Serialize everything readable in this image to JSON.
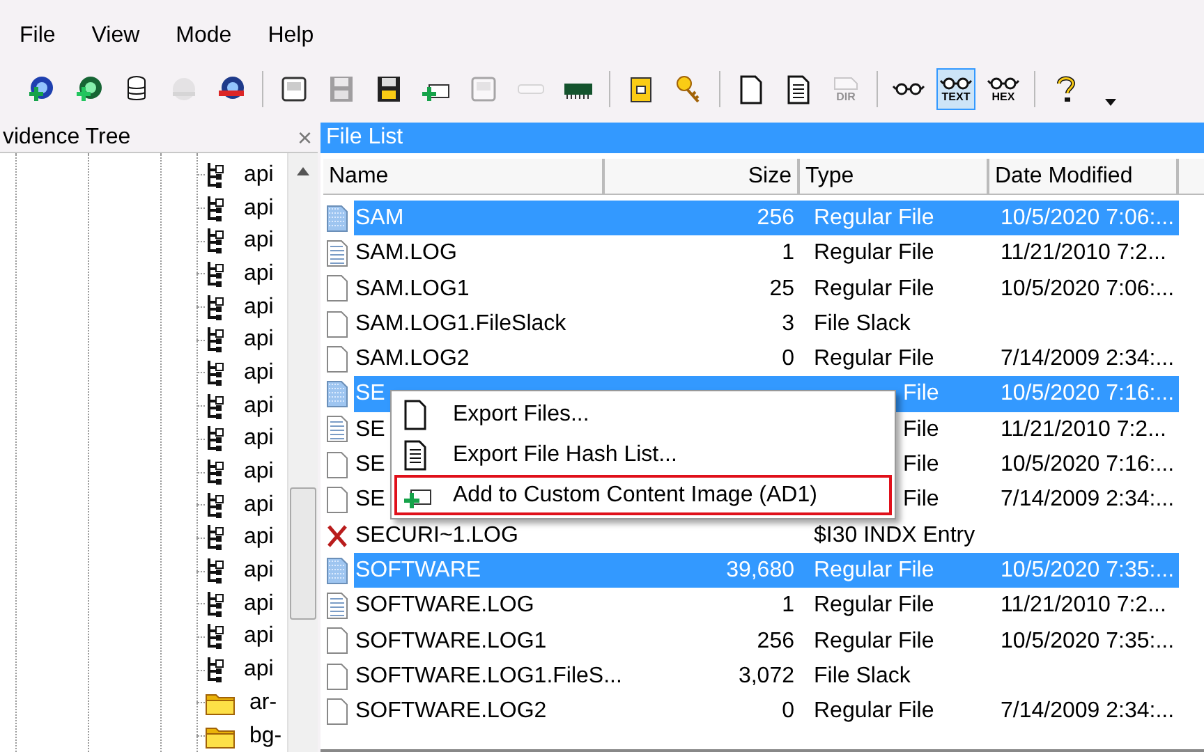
{
  "menu": [
    {
      "label": "File"
    },
    {
      "label": "View"
    },
    {
      "label": "Mode"
    },
    {
      "label": "Help"
    }
  ],
  "toolbar": [
    {
      "kind": "add-evidence",
      "disabled": false,
      "selected": false
    },
    {
      "kind": "add-all",
      "disabled": false,
      "selected": false
    },
    {
      "kind": "stack",
      "disabled": false,
      "selected": false
    },
    {
      "kind": "remove-evidence",
      "disabled": true,
      "selected": false
    },
    {
      "kind": "remove-all",
      "disabled": false,
      "selected": false
    },
    {
      "kind": "separator"
    },
    {
      "kind": "drive",
      "disabled": false,
      "selected": false
    },
    {
      "kind": "floppy",
      "disabled": true,
      "selected": false
    },
    {
      "kind": "floppy",
      "disabled": false,
      "selected": false
    },
    {
      "kind": "add-image",
      "disabled": false,
      "selected": false
    },
    {
      "kind": "drive",
      "disabled": true,
      "selected": false
    },
    {
      "kind": "bar",
      "disabled": true,
      "selected": false
    },
    {
      "kind": "memory",
      "disabled": false,
      "selected": false
    },
    {
      "kind": "separator"
    },
    {
      "kind": "case",
      "disabled": false,
      "selected": false
    },
    {
      "kind": "key",
      "disabled": false,
      "selected": false
    },
    {
      "kind": "separator"
    },
    {
      "kind": "page",
      "disabled": false,
      "selected": false
    },
    {
      "kind": "lines",
      "disabled": false,
      "selected": false
    },
    {
      "kind": "tagged",
      "label": "DIR",
      "disabled": true,
      "selected": false
    },
    {
      "kind": "separator"
    },
    {
      "kind": "glasses",
      "disabled": false,
      "selected": false
    },
    {
      "kind": "glasses",
      "label": "TEXT",
      "disabled": false,
      "selected": true
    },
    {
      "kind": "glasses",
      "label": "HEX",
      "disabled": false,
      "selected": false
    },
    {
      "kind": "separator"
    },
    {
      "kind": "help",
      "disabled": false,
      "selected": false
    },
    {
      "kind": "caret"
    }
  ],
  "evidence_tree": {
    "title": "vidence Tree",
    "close": "×",
    "items": [
      {
        "kind": "key",
        "label": "api"
      },
      {
        "kind": "key",
        "label": "api"
      },
      {
        "kind": "key",
        "label": "api"
      },
      {
        "kind": "key",
        "label": "api"
      },
      {
        "kind": "key",
        "label": "api"
      },
      {
        "kind": "key",
        "label": "api"
      },
      {
        "kind": "key",
        "label": "api"
      },
      {
        "kind": "key",
        "label": "api"
      },
      {
        "kind": "key",
        "label": "api"
      },
      {
        "kind": "key",
        "label": "api"
      },
      {
        "kind": "key",
        "label": "api"
      },
      {
        "kind": "key",
        "label": "api"
      },
      {
        "kind": "key",
        "label": "api"
      },
      {
        "kind": "key",
        "label": "api"
      },
      {
        "kind": "key",
        "label": "api"
      },
      {
        "kind": "key",
        "label": "api"
      },
      {
        "kind": "folder",
        "label": "ar-"
      },
      {
        "kind": "folder",
        "label": "bg-"
      }
    ]
  },
  "file_list": {
    "title": "File List",
    "columns": [
      "Name",
      "Size",
      "Type",
      "Date Modified"
    ],
    "rows": [
      {
        "kind": "registry",
        "name": "SAM",
        "size": "256",
        "type": "Regular File",
        "date": "10/5/2020 7:06:...",
        "selected": true
      },
      {
        "kind": "log",
        "name": "SAM.LOG",
        "size": "1",
        "type": "Regular File",
        "date": "11/21/2010 7:2...",
        "selected": false
      },
      {
        "kind": "file",
        "name": "SAM.LOG1",
        "size": "25",
        "type": "Regular File",
        "date": "10/5/2020 7:06:...",
        "selected": false
      },
      {
        "kind": "file",
        "name": "SAM.LOG1.FileSlack",
        "size": "3",
        "type": "File Slack",
        "selected": false
      },
      {
        "kind": "file",
        "name": "SAM.LOG2",
        "size": "0",
        "type": "Regular File",
        "date": "7/14/2009 2:34:...",
        "selected": false
      },
      {
        "kind": "registry",
        "name": "SE",
        "type": "File",
        "date": "10/5/2020 7:16:...",
        "selected": true,
        "covered": true
      },
      {
        "kind": "log",
        "name": "SE",
        "type": "File",
        "date": "11/21/2010 7:2...",
        "selected": false,
        "covered": true
      },
      {
        "kind": "file",
        "name": "SE",
        "type": "File",
        "date": "10/5/2020 7:16:...",
        "selected": false,
        "covered": true
      },
      {
        "kind": "file",
        "name": "SE",
        "type": "File",
        "date": "7/14/2009 2:34:...",
        "selected": false,
        "covered": true
      },
      {
        "kind": "deleted",
        "name": "SECURI~1.LOG",
        "type": "$I30 INDX Entry",
        "selected": false
      },
      {
        "kind": "registry",
        "name": "SOFTWARE",
        "size": "39,680",
        "type": "Regular File",
        "date": "10/5/2020 7:35:...",
        "selected": true
      },
      {
        "kind": "log",
        "name": "SOFTWARE.LOG",
        "size": "1",
        "type": "Regular File",
        "date": "11/21/2010 7:2...",
        "selected": false
      },
      {
        "kind": "file",
        "name": "SOFTWARE.LOG1",
        "size": "256",
        "type": "Regular File",
        "date": "10/5/2020 7:35:...",
        "selected": false
      },
      {
        "kind": "file",
        "name": "SOFTWARE.LOG1.FileS...",
        "size": "3,072",
        "type": "File Slack",
        "selected": false
      },
      {
        "kind": "file",
        "name": "SOFTWARE.LOG2",
        "size": "0",
        "type": "Regular File",
        "date": "7/14/2009 2:34:...",
        "selected": false
      }
    ]
  },
  "context_menu": [
    {
      "kind": "page",
      "label": "Export Files...",
      "outlined": false
    },
    {
      "kind": "lines",
      "label": "Export File Hash List...",
      "outlined": false
    },
    {
      "kind": "add-image",
      "label": "Add to Custom Content Image (AD1)",
      "outlined": true
    }
  ]
}
